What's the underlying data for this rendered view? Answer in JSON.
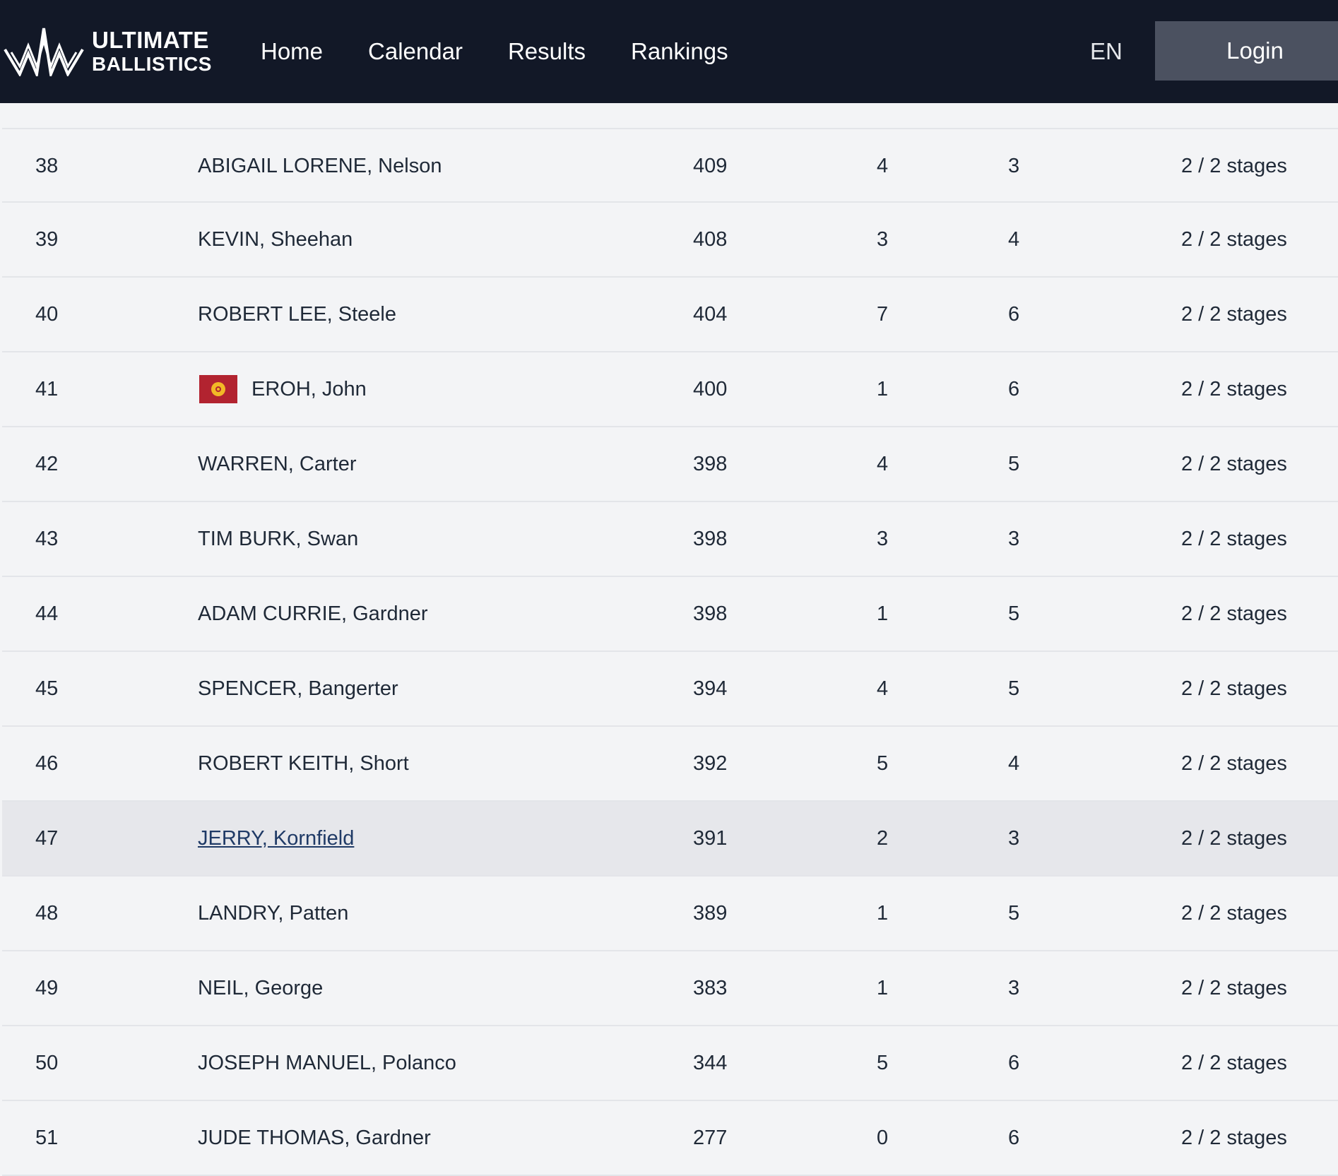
{
  "header": {
    "logo_line1": "ULTIMATE",
    "logo_line2": "BALLISTICS",
    "nav": [
      {
        "label": "Home"
      },
      {
        "label": "Calendar"
      },
      {
        "label": "Results"
      },
      {
        "label": "Rankings"
      }
    ],
    "language": "EN",
    "login_label": "Login",
    "colors": {
      "bar": "#121827",
      "login_bg": "#4b5160"
    }
  },
  "results": {
    "rows": [
      {
        "rank": "38",
        "name": "ABIGAIL LORENE, Nelson",
        "score": "409",
        "col_a": "4",
        "col_b": "3",
        "stages": "2 / 2 stages"
      },
      {
        "rank": "39",
        "name": "KEVIN, Sheehan",
        "score": "408",
        "col_a": "3",
        "col_b": "4",
        "stages": "2 / 2 stages"
      },
      {
        "rank": "40",
        "name": "ROBERT LEE, Steele",
        "score": "404",
        "col_a": "7",
        "col_b": "6",
        "stages": "2 / 2 stages"
      },
      {
        "rank": "41",
        "name": "EROH, John",
        "score": "400",
        "col_a": "1",
        "col_b": "6",
        "stages": "2 / 2 stages",
        "flag_icon": "kyrgyzstan-flag-icon"
      },
      {
        "rank": "42",
        "name": "WARREN, Carter",
        "score": "398",
        "col_a": "4",
        "col_b": "5",
        "stages": "2 / 2 stages"
      },
      {
        "rank": "43",
        "name": "TIM BURK, Swan",
        "score": "398",
        "col_a": "3",
        "col_b": "3",
        "stages": "2 / 2 stages"
      },
      {
        "rank": "44",
        "name": "ADAM CURRIE, Gardner",
        "score": "398",
        "col_a": "1",
        "col_b": "5",
        "stages": "2 / 2 stages"
      },
      {
        "rank": "45",
        "name": "SPENCER, Bangerter",
        "score": "394",
        "col_a": "4",
        "col_b": "5",
        "stages": "2 / 2 stages"
      },
      {
        "rank": "46",
        "name": "ROBERT KEITH, Short",
        "score": "392",
        "col_a": "5",
        "col_b": "4",
        "stages": "2 / 2 stages"
      },
      {
        "rank": "47",
        "name": "JERRY, Kornfield",
        "score": "391",
        "col_a": "2",
        "col_b": "3",
        "stages": "2 / 2 stages",
        "hovered": true
      },
      {
        "rank": "48",
        "name": "LANDRY, Patten",
        "score": "389",
        "col_a": "1",
        "col_b": "5",
        "stages": "2 / 2 stages"
      },
      {
        "rank": "49",
        "name": "NEIL, George",
        "score": "383",
        "col_a": "1",
        "col_b": "3",
        "stages": "2 / 2 stages"
      },
      {
        "rank": "50",
        "name": "JOSEPH MANUEL, Polanco",
        "score": "344",
        "col_a": "5",
        "col_b": "6",
        "stages": "2 / 2 stages"
      },
      {
        "rank": "51",
        "name": "JUDE THOMAS, Gardner",
        "score": "277",
        "col_a": "0",
        "col_b": "6",
        "stages": "2 / 2 stages"
      }
    ]
  }
}
